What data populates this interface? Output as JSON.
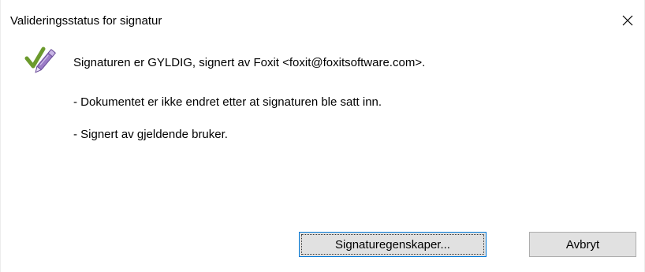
{
  "window": {
    "title": "Valideringsstatus for signatur"
  },
  "status": {
    "icon": "signature-valid-check-pen-icon",
    "main_message": "Signaturen er GYLDIG, signert av Foxit <foxit@foxitsoftware.com>.",
    "details": [
      "- Dokumentet er ikke endret etter at signaturen ble satt inn.",
      "- Signert av gjeldende bruker."
    ]
  },
  "buttons": {
    "properties_label": "Signaturegenskaper...",
    "cancel_label": "Avbryt"
  },
  "colors": {
    "check_green": "#6b9a2c",
    "pen_purple": "#8a6ab8",
    "focus_blue": "#0078d7",
    "button_face": "#e1e1e1"
  }
}
